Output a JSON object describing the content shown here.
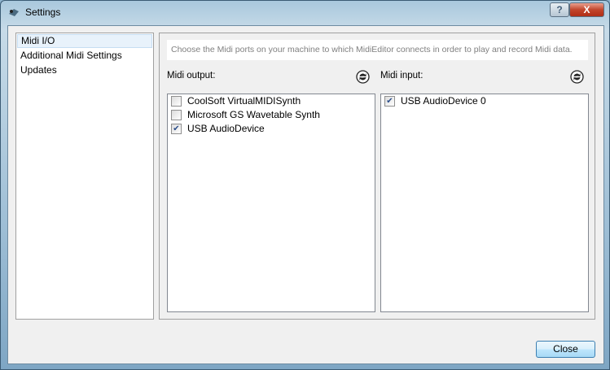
{
  "window": {
    "title": "Settings",
    "help_label": "?",
    "close_label": "X"
  },
  "sidebar": {
    "items": [
      {
        "label": "Midi I/O"
      },
      {
        "label": "Additional Midi Settings"
      },
      {
        "label": "Updates"
      }
    ]
  },
  "main": {
    "info": "Choose the Midi ports on your machine to which MidiEditor connects in order to play and record Midi data.",
    "output": {
      "label": "Midi output:",
      "items": [
        {
          "label": "CoolSoft VirtualMIDISynth",
          "checked": false
        },
        {
          "label": "Microsoft GS Wavetable Synth",
          "checked": false
        },
        {
          "label": "USB AudioDevice",
          "checked": true
        }
      ]
    },
    "input": {
      "label": "Midi input:",
      "items": [
        {
          "label": "USB AudioDevice 0",
          "checked": true
        }
      ]
    }
  },
  "footer": {
    "close_label": "Close"
  }
}
